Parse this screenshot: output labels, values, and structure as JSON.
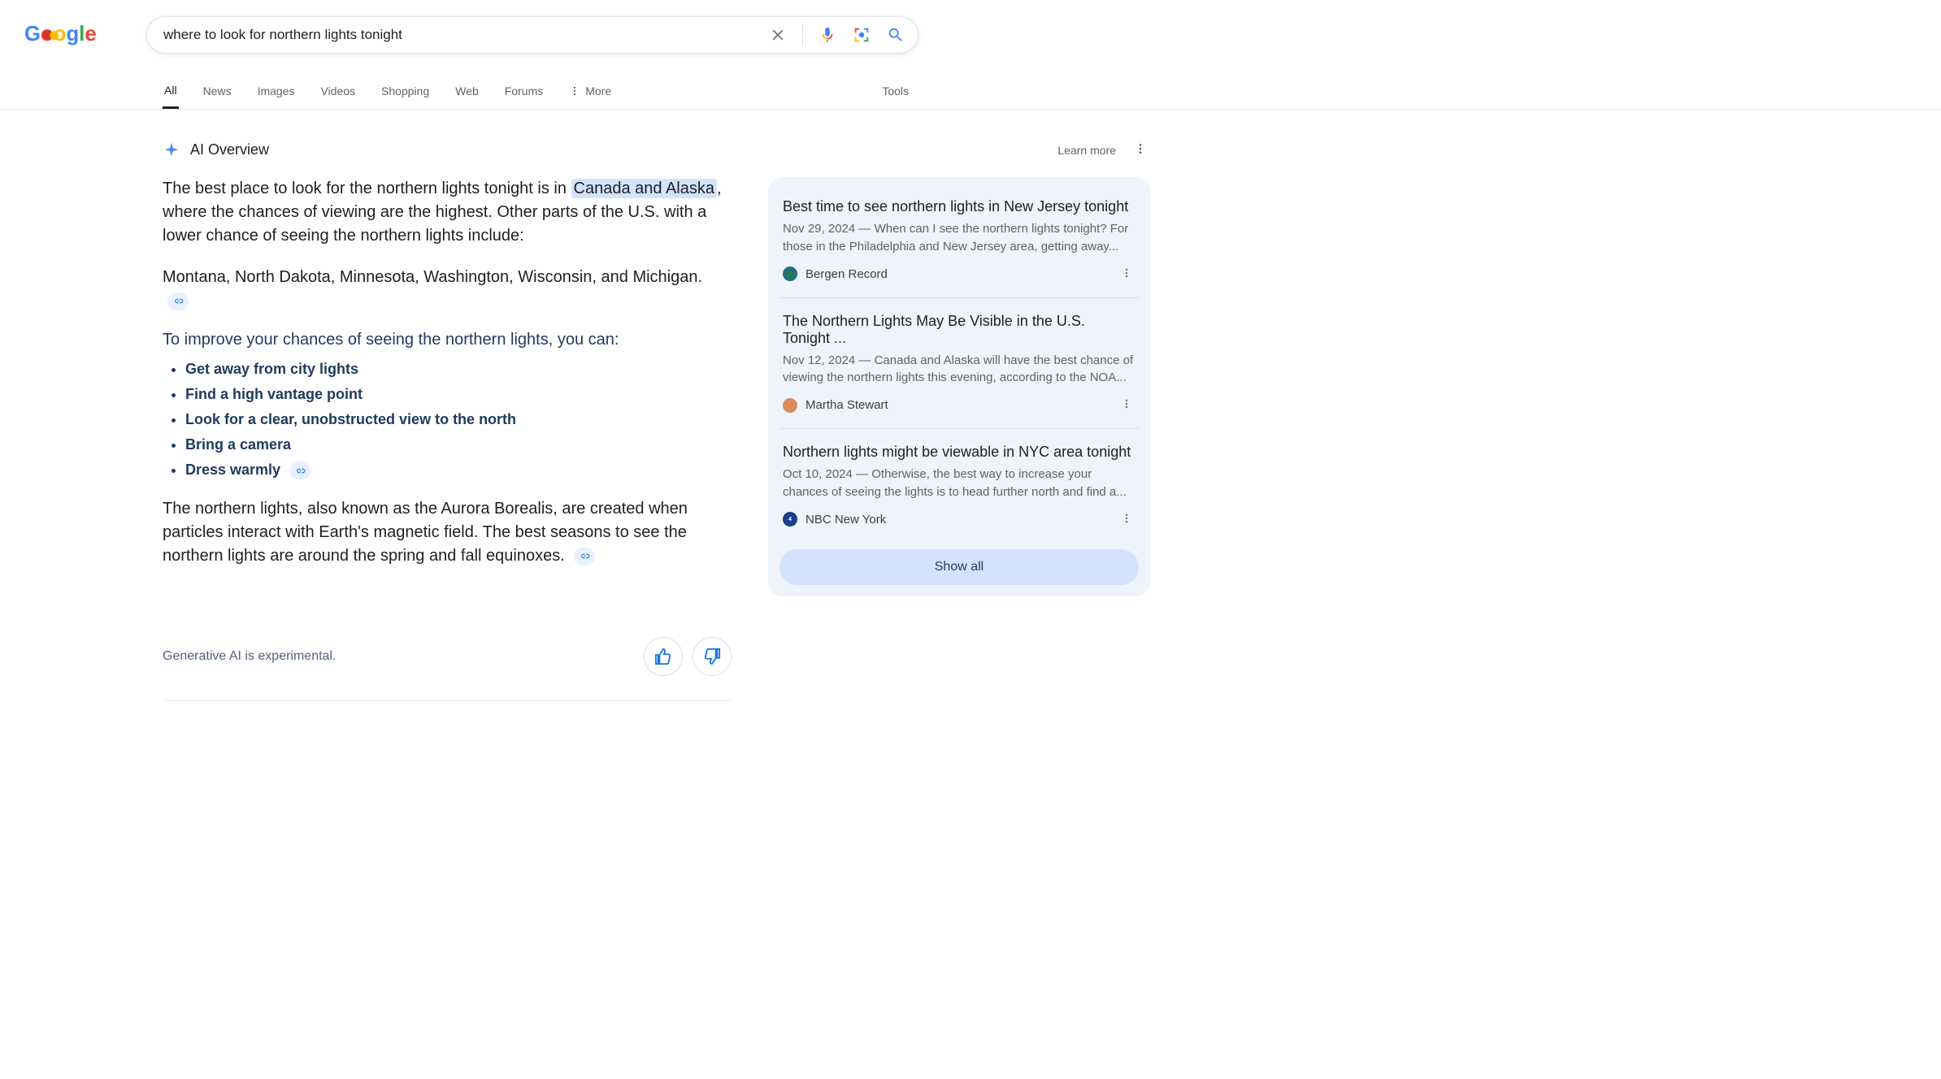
{
  "search": {
    "query": "where to look for northern lights tonight"
  },
  "tabs": [
    "All",
    "News",
    "Images",
    "Videos",
    "Shopping",
    "Web",
    "Forums"
  ],
  "tabs_more": "More",
  "tools": "Tools",
  "ai_overview": {
    "label": "AI Overview",
    "learn_more": "Learn more",
    "p1_a": "The best place to look for the northern lights tonight is in ",
    "p1_hl": "Canada and Alaska",
    "p1_b": ", where the chances of viewing are the highest. Other parts of the U.S. with a lower chance of seeing the northern lights include:",
    "p2": "Montana, North Dakota, Minnesota, Washington, Wisconsin, and Michigan.",
    "h2": "To improve your chances of seeing the northern lights, you can:",
    "bullets": [
      "Get away from city lights",
      "Find a high vantage point",
      "Look for a clear, unobstructed view to the north",
      "Bring a camera",
      "Dress warmly"
    ],
    "p3": "The northern lights, also known as the Aurora Borealis, are created when particles interact with Earth's magnetic field. The best seasons to see the northern lights are around the spring and fall equinoxes."
  },
  "sources": [
    {
      "title": "Best time to see northern lights in New Jersey tonight",
      "date": "Nov 29, 2024",
      "snippet": "When can I see the northern lights tonight? For those in the Philadelphia and New Jersey area, getting away...",
      "publisher": "Bergen Record",
      "favicon": "#2e7d32"
    },
    {
      "title": "The Northern Lights May Be Visible in the U.S. Tonight ...",
      "date": "Nov 12, 2024",
      "snippet": "Canada and Alaska will have the best chance of viewing the northern lights this evening, according to the NOA...",
      "publisher": "Martha Stewart",
      "favicon": "#d98c5a"
    },
    {
      "title": "Northern lights might be viewable in NYC area tonight",
      "date": "Oct 10, 2024",
      "snippet": "Otherwise, the best way to increase your chances of seeing the lights is to head further north and find a...",
      "publisher": "NBC New York",
      "favicon": "#1a3e8c"
    }
  ],
  "show_all": "Show all",
  "footer": {
    "disclaimer": "Generative AI is experimental."
  }
}
